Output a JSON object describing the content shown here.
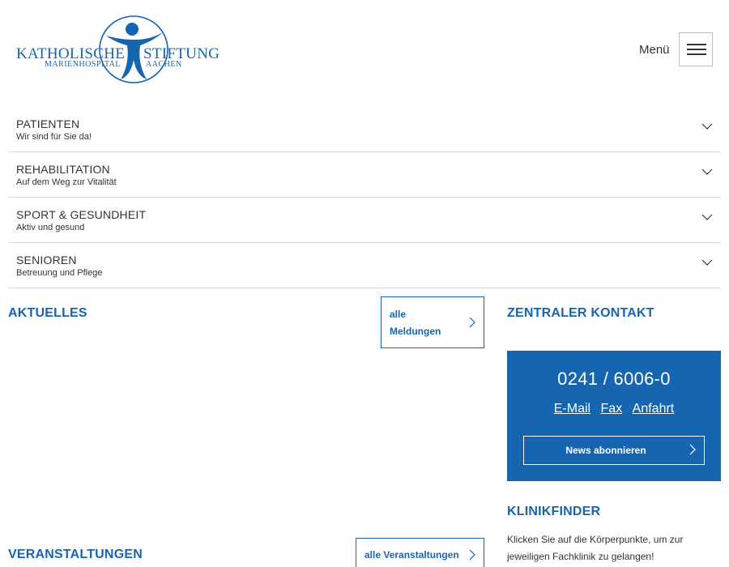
{
  "logo": {
    "left_word": "KATHOLISCHE",
    "right_word": "STIFTUNG",
    "sub_left": "MARIENHOSPITAL",
    "sub_right": "AACHEN"
  },
  "header": {
    "menu_label": "Menü"
  },
  "nav": {
    "items": [
      {
        "title": "PATIENTEN",
        "subtitle": "Wir sind für Sie da!"
      },
      {
        "title": "REHABILITATION",
        "subtitle": "Auf dem Weg zur Vitalität"
      },
      {
        "title": "SPORT & GESUNDHEIT",
        "subtitle": "Aktiv und gesund"
      },
      {
        "title": "SENIOREN",
        "subtitle": "Betreuung und Pflege"
      }
    ]
  },
  "news": {
    "title": "AKTUELLES",
    "all_button": "alle Meldungen"
  },
  "events": {
    "title": "VERANSTALTUNGEN",
    "all_button": "alle Veranstaltungen"
  },
  "contact": {
    "title": "ZENTRALER KONTAKT",
    "phone": "0241 / 6006-0",
    "links": [
      "E-Mail",
      "Fax",
      "Anfahrt"
    ],
    "news_button": "News abonnieren"
  },
  "klinikfinder": {
    "title": "KLINIKFINDER",
    "text": "Klicken Sie auf die Körperpunkte, um zur jeweiligen Fachklinik zu gelangen!"
  },
  "colors": {
    "brand_blue": "#1565b0",
    "text": "#333333",
    "divider": "#d9d9d9"
  },
  "icons": [
    "logo-figure-icon",
    "hamburger-icon",
    "chevron-down-icon",
    "chevron-right-icon"
  ]
}
